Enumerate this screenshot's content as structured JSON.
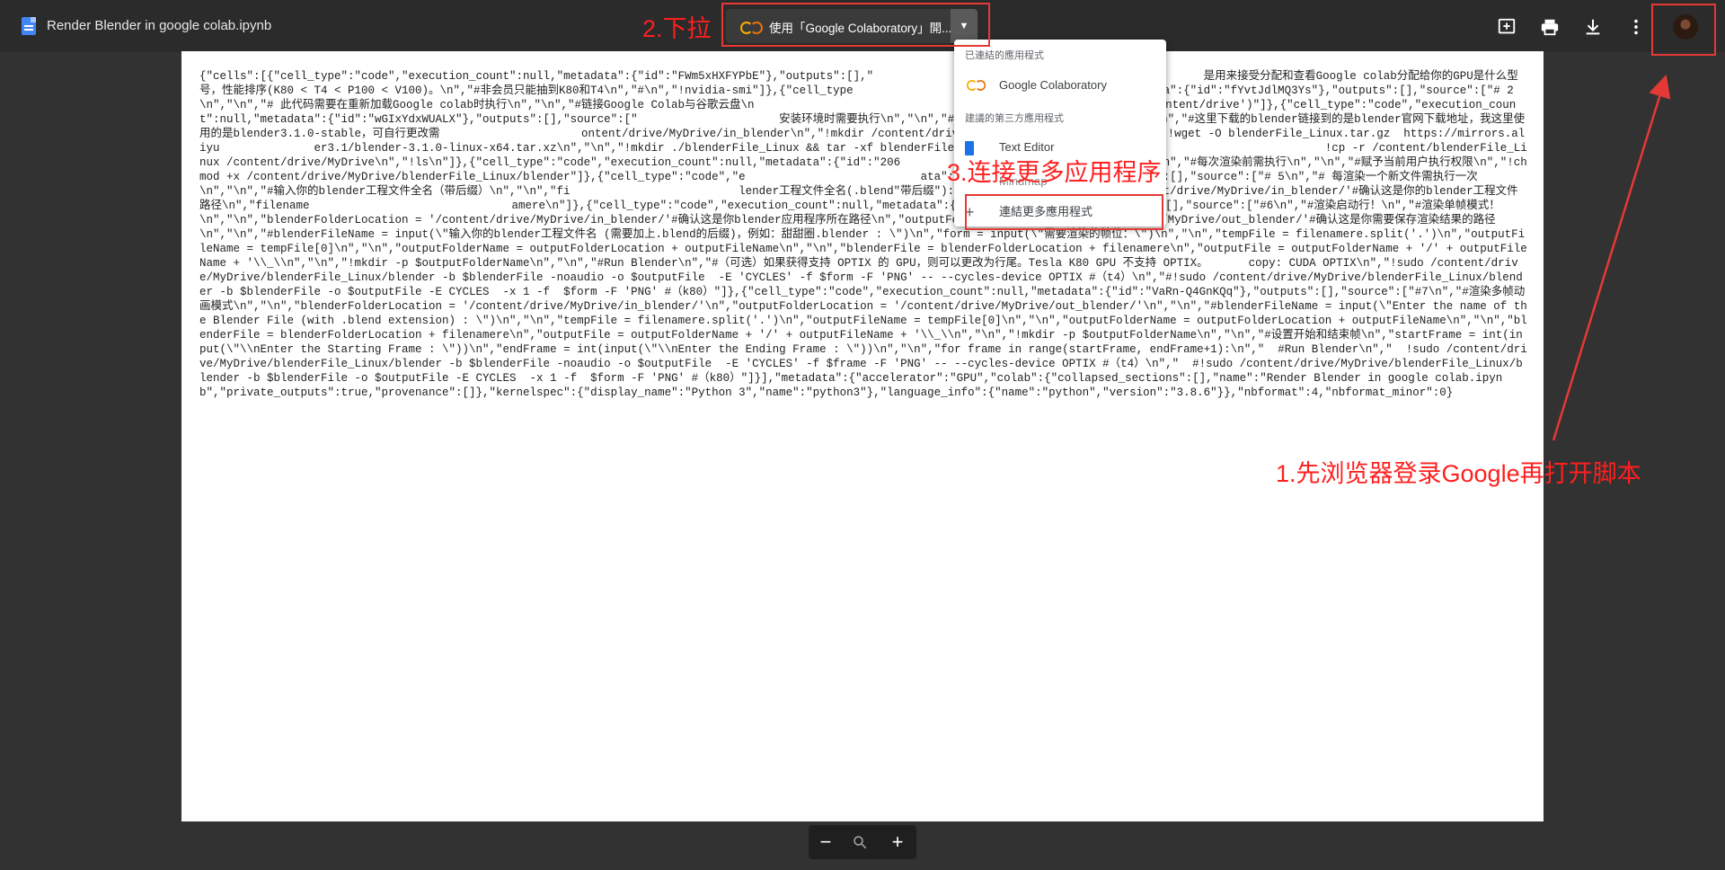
{
  "header": {
    "file_title": "Render Blender in google colab.ipynb",
    "open_with_label": "使用「Google Colaboratory」開...",
    "icons": [
      "add-comment-icon",
      "print-icon",
      "download-icon",
      "more-vert-icon"
    ]
  },
  "menu": {
    "section_connected": "已連結的應用程式",
    "connected_app": "Google Colaboratory",
    "section_suggested": "建議的第三方應用程式",
    "suggested_app_1": "Text Editor",
    "suggested_app_2": "Mindmap",
    "connect_more": "連結更多應用程式"
  },
  "document": {
    "content": "{\"cells\":[{\"cell_type\":\"code\",\"execution_count\":null,\"metadata\":{\"id\":\"FWm5xHXFYPbE\"},\"outputs\":[],\"                                                 是用来接受分配和查看Google colab分配给你的GPU是什么型号，性能排序(K80 < T4 < P100 < V100)。\\n\",\"#非会员只能抽到K80和T4\\n\",\"#\\n\",\"!nvidia-smi\"]},{\"cell_type                                 null,\"metadata\":{\"id\":\"fYvtJdlMQ3Ys\"},\"outputs\":[],\"source\":[\"# 2\\n\",\"\\n\",\"# 此代码需要在重新加载Google colab时执行\\n\",\"\\n\",\"#链接Google Colab与谷歌云盘\\n                              port drive\\n\",\"drive.mount('/content/drive')\"]},{\"cell_type\":\"code\",\"execution_count\":null,\"metadata\":{\"id\":\"wGIxYdxWUALX\"},\"outputs\":[],\"source\":[\"                     安装环境时需要执行\\n\",\"\\n\",\"#下载blender程序到自己的Google云盘\\n\",\"#这里下载的blender链接到的是blender官网下载地址，我这里使用的是blender3.1.0-stable，可自行更改需                     ontent/drive/MyDrive/in_blender\\n\",\"!mkdir /content/drive/MyDrive/out_blender\\n\",\"\\n\",\"!wget -O blenderFile_Linux.tar.gz  https://mirrors.aliyu              er3.1/blender-3.1.0-linux-x64.tar.xz\\n\",\"\\n\",\"!mkdir ./blenderFile_Linux && tar -xf blenderFile_Linux.tar.gz -C ./blenderFile                         !cp -r /content/blenderFile_Linux /content/drive/MyDrive\\n\",\"!ls\\n\"]},{\"cell_type\":\"code\",\"execution_count\":null,\"metadata\":{\"id\":\"206                          ource\":[\"# 4\\n\",\"#每次渲染前需执行\\n\",\"\\n\",\"#赋予当前用户执行权限\\n\",\"!chmod +x /content/drive/MyDrive/blenderFile_Linux/blender\"]},{\"cell_type\":\"code\",\"e                          ata\":{\"id\":\"oA7WuVVQXzev\"},\"outputs\":[],\"source\":[\"# 5\\n\",\"# 每渲染一个新文件需执行一次\\n\",\"\\n\",\"#输入你的blender工程文件全名（带后缀）\\n\",\"\\n\",\"fi                         lender工程文件全名(.blend\"带后缀\"):\\\")\\n\",\"filenameroad = '/content/drive/MyDrive/in_blender/'#确认这是你的blender工程文件路径\\n\",\"filename                              amere\\n\"]},{\"cell_type\":\"code\",\"execution_count\":null,\"metadata\":{\"id\":\"DFBawXD1AK3V\"},\"outputs\":[],\"source\":[\"#6\\n\",\"#渲染启动行！\\n\",\"#渲染单帧模式！\\n\",\"\\n\",\"blenderFolderLocation = '/content/drive/MyDrive/in_blender/'#确认这是你blender应用程序所在路径\\n\",\"outputFolderLocation = '/content/drive/MyDrive/out_blender/'#确认这是你需要保存渲染结果的路径\\n\",\"\\n\",\"#blenderFileName = input(\\\"输入你的blender工程文件名 (需要加上.blend的后缀)，例如：甜甜圈.blender : \\\")\\n\",\"form = input(\\\"需要渲染的帧位：\\\")\\n\",\"\\n\",\"tempFile = filenamere.split('.')\\n\",\"outputFileName = tempFile[0]\\n\",\"\\n\",\"outputFolderName = outputFolderLocation + outputFileName\\n\",\"\\n\",\"blenderFile = blenderFolderLocation + filenamere\\n\",\"outputFile = outputFolderName + '/' + outputFileName + '\\\\_\\\\n\",\"\\n\",\"!mkdir -p $outputFolderName\\n\",\"\\n\",\"#Run Blender\\n\",\"#（可选）如果获得支持 OPTIX 的 GPU，则可以更改为行尾。Tesla K80 GPU 不支持 OPTIX。      copy: CUDA OPTIX\\n\",\"!sudo /content/drive/MyDrive/blenderFile_Linux/blender -b $blenderFile -noaudio -o $outputFile  -E 'CYCLES' -f $form -F 'PNG' -- --cycles-device OPTIX #（t4）\\n\",\"#!sudo /content/drive/MyDrive/blenderFile_Linux/blender -b $blenderFile -o $outputFile -E CYCLES  -x 1 -f  $form -F 'PNG' #（k80）\"]},{\"cell_type\":\"code\",\"execution_count\":null,\"metadata\":{\"id\":\"VaRn-Q4GnKQq\"},\"outputs\":[],\"source\":[\"#7\\n\",\"#渲染多帧动画模式\\n\",\"\\n\",\"blenderFolderLocation = '/content/drive/MyDrive/in_blender/'\\n\",\"outputFolderLocation = '/content/drive/MyDrive/out_blender/'\\n\",\"\\n\",\"#blenderFileName = input(\\\"Enter the name of the Blender File (with .blend extension) : \\\")\\n\",\"\\n\",\"tempFile = filenamere.split('.')\\n\",\"outputFileName = tempFile[0]\\n\",\"\\n\",\"outputFolderName = outputFolderLocation + outputFileName\\n\",\"\\n\",\"blenderFile = blenderFolderLocation + filenamere\\n\",\"outputFile = outputFolderName + '/' + outputFileName + '\\\\_\\\\n\",\"\\n\",\"!mkdir -p $outputFolderName\\n\",\"\\n\",\"#设置开始和结束帧\\n\",\"startFrame = int(input(\\\"\\\\nEnter the Starting Frame : \\\"))\\n\",\"endFrame = int(input(\\\"\\\\nEnter the Ending Frame : \\\"))\\n\",\"\\n\",\"for frame in range(startFrame, endFrame+1):\\n\",\"  #Run Blender\\n\",\"  !sudo /content/drive/MyDrive/blenderFile_Linux/blender -b $blenderFile -noaudio -o $outputFile  -E 'CYCLES' -f $frame -F 'PNG' -- --cycles-device OPTIX #（t4）\\n\",\"  #!sudo /content/drive/MyDrive/blenderFile_Linux/blender -b $blenderFile -o $outputFile -E CYCLES  -x 1 -f  $form -F 'PNG' #（k80）\"]}],\"metadata\":{\"accelerator\":\"GPU\",\"colab\":{\"collapsed_sections\":[],\"name\":\"Render Blender in google colab.ipynb\",\"private_outputs\":true,\"provenance\":[]},\"kernelspec\":{\"display_name\":\"Python 3\",\"name\":\"python3\"},\"language_info\":{\"name\":\"python\",\"version\":\"3.8.6\"}},\"nbformat\":4,\"nbformat_minor\":0}"
  },
  "zoom": {
    "minus": "−",
    "plus": "+"
  },
  "annotations": {
    "step1": "1.先浏览器登录Google再打开脚本",
    "step2": "2.下拉",
    "step3": "3.连接更多应用程序"
  },
  "colors": {
    "annotation_red": "#e53935",
    "topbar": "#2b2b2b",
    "background": "#323232"
  }
}
